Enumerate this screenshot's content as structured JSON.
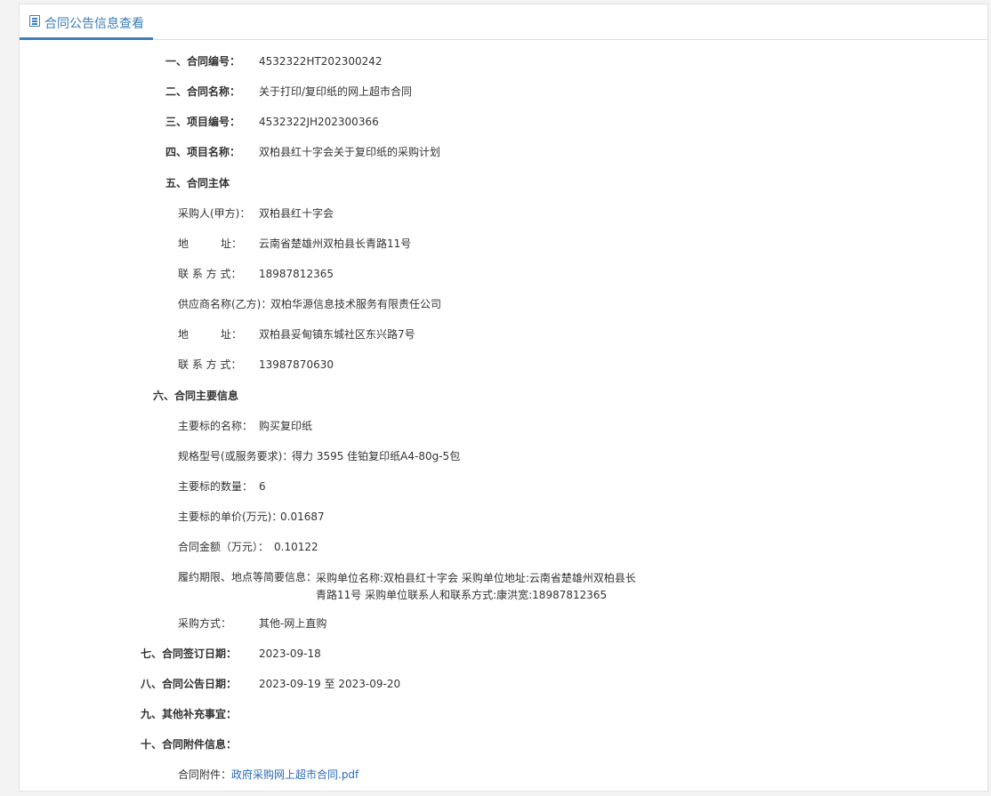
{
  "header": {
    "title": "合同公告信息查看",
    "icon": "document-icon",
    "accent": "#3c7fb8"
  },
  "s1": {
    "label": "一、合同编号：",
    "value": "4532322HT202300242"
  },
  "s2": {
    "label": "二、合同名称：",
    "value": "关于打印/复印纸的网上超市合同"
  },
  "s3": {
    "label": "三、项目编号：",
    "value": "4532322JH202300366"
  },
  "s4": {
    "label": "四、项目名称：",
    "value": "双柏县红十字会关于复印纸的采购计划"
  },
  "s5": {
    "label": "五、合同主体",
    "buyer_label": "采购人(甲方)：",
    "buyer": "双柏县红十字会",
    "buyer_addr_label": "地　　　址：",
    "buyer_addr": "云南省楚雄州双柏县长青路11号",
    "buyer_contact_label": "联 系 方 式：",
    "buyer_contact": "18987812365",
    "supplier_label": "供应商名称(乙方)：",
    "supplier": "双柏华源信息技术服务有限责任公司",
    "supplier_addr_label": "地　　　址：",
    "supplier_addr": "双柏县妥甸镇东城社区东兴路7号",
    "supplier_contact_label": "联 系 方 式：",
    "supplier_contact": "13987870630"
  },
  "s6": {
    "label": "六、合同主要信息",
    "item_name_label": "主要标的名称：",
    "item_name": "购买复印纸",
    "spec_label": "规格型号(或服务要求)：",
    "spec": "得力 3595 佳铂复印纸A4-80g-5包",
    "qty_label": "主要标的数量：",
    "qty": "6",
    "unit_price_label": "主要标的单价(万元)：",
    "unit_price": "0.01687",
    "amount_label": "合同金额（万元）：",
    "amount": "0.10122",
    "period_label": "履约期限、地点等简要信息：",
    "period": "采购单位名称:双柏县红十字会 采购单位地址:云南省楚雄州双柏县长青路11号 采购单位联系人和联系方式:康洪宽:18987812365",
    "method_label": "采购方式：",
    "method": "其他-网上直购"
  },
  "s7": {
    "label": "七、合同签订日期：",
    "value": "2023-09-18"
  },
  "s8": {
    "label": "八、合同公告日期：",
    "value": "2023-09-19 至 2023-09-20"
  },
  "s9": {
    "label": "九、其他补充事宜："
  },
  "s10": {
    "label": "十、合同附件信息：",
    "attach_label": "合同附件：",
    "attach_link": "政府采购网上超市合同.pdf"
  }
}
